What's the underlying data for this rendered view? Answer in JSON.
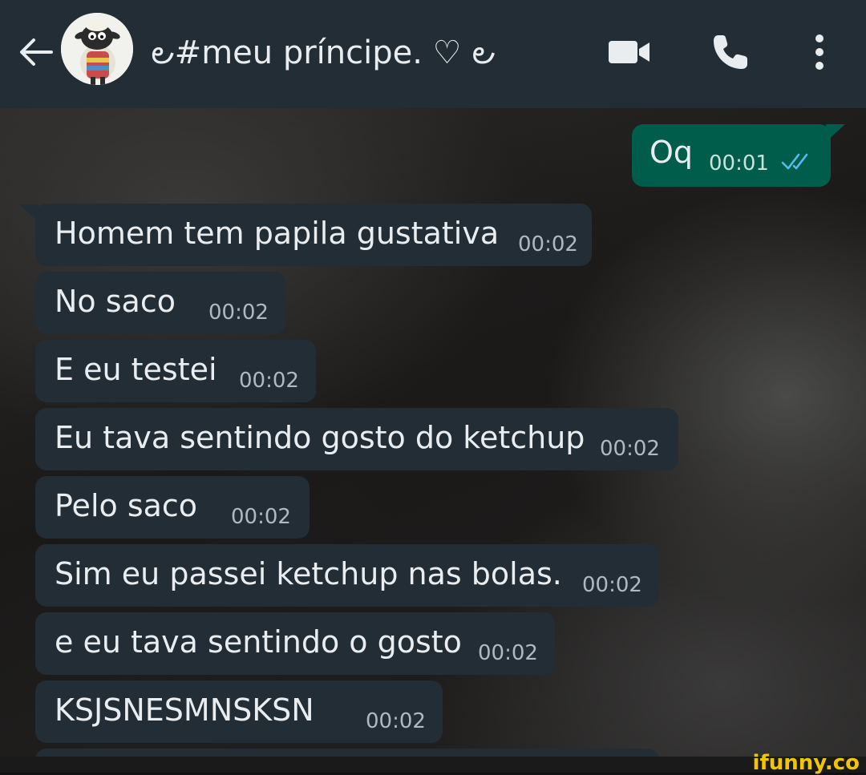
{
  "header": {
    "contact_name": "౿#meu príncipe. ♡ ౿",
    "background": "#232d36"
  },
  "messages": [
    {
      "direction": "out",
      "text": "Oq",
      "time": "00:01",
      "status": "read"
    },
    {
      "direction": "in",
      "text": "Homem tem papila gustativa",
      "time": "00:02"
    },
    {
      "direction": "in",
      "text": "No saco",
      "time": "00:02"
    },
    {
      "direction": "in",
      "text": "E eu testei",
      "time": "00:02"
    },
    {
      "direction": "in",
      "text": "Eu tava sentindo gosto do ketchup",
      "time": "00:02"
    },
    {
      "direction": "in",
      "text": "Pelo saco",
      "time": "00:02"
    },
    {
      "direction": "in",
      "text": "Sim eu passei ketchup nas bolas.",
      "time": "00:02"
    },
    {
      "direction": "in",
      "text": "e eu tava sentindo o gosto",
      "time": "00:02"
    },
    {
      "direction": "in",
      "text": "KSJSNESMNSKSN",
      "time": "00:02"
    }
  ],
  "watermark": "ifunny.co",
  "colors": {
    "incoming_bubble": "#232d36",
    "outgoing_bubble": "#005c4b",
    "read_ticks": "#53bdeb",
    "watermark": "#f2c500"
  }
}
